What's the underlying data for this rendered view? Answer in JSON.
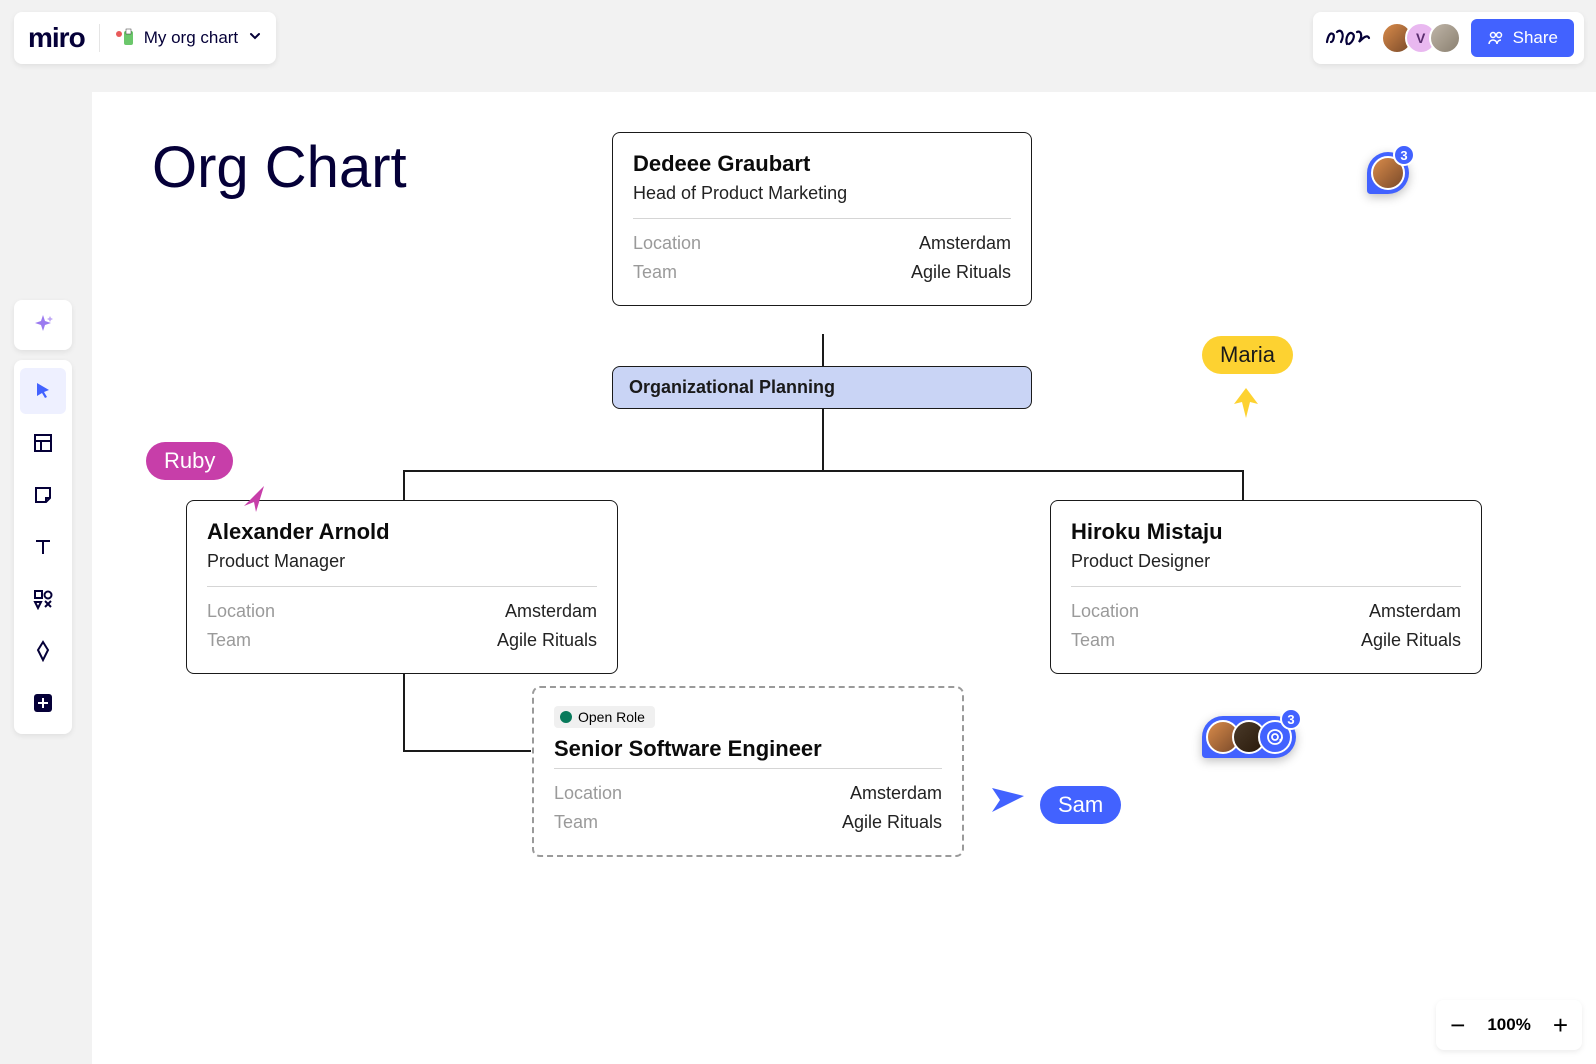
{
  "app": {
    "logo": "miro",
    "board_name": "My org chart"
  },
  "share_label": "Share",
  "avatar_letter": "V",
  "canvas": {
    "title": "Org Chart",
    "mid_label": "Organizational Planning",
    "cards": {
      "top": {
        "name": "Dedeee Graubart",
        "role": "Head of Product Marketing",
        "location_label": "Location",
        "location": "Amsterdam",
        "team_label": "Team",
        "team": "Agile Rituals"
      },
      "left": {
        "name": "Alexander Arnold",
        "role": "Product Manager",
        "location_label": "Location",
        "location": "Amsterdam",
        "team_label": "Team",
        "team": "Agile Rituals"
      },
      "right": {
        "name": "Hiroku Mistaju",
        "role": "Product Designer",
        "location_label": "Location",
        "location": "Amsterdam",
        "team_label": "Team",
        "team": "Agile Rituals"
      },
      "open": {
        "badge": "Open Role",
        "name": "Senior Software Engineer",
        "location_label": "Location",
        "location": "Amsterdam",
        "team_label": "Team",
        "team": "Agile Rituals"
      }
    },
    "cursors": {
      "ruby": "Ruby",
      "maria": "Maria",
      "sam": "Sam"
    },
    "comment_counts": {
      "c1": "3",
      "c2": "3"
    }
  },
  "zoom": "100%"
}
